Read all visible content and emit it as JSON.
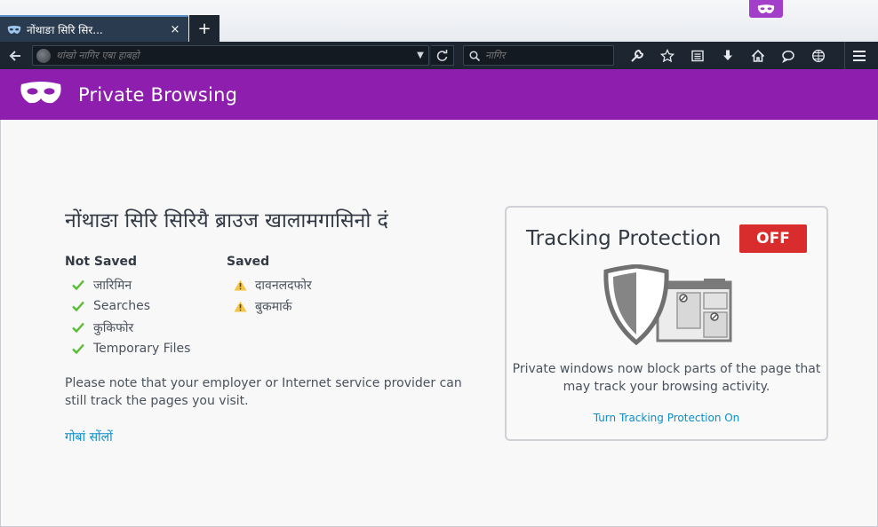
{
  "tab": {
    "title": "नोंथाङा सिरि सिर...",
    "close_label": "×",
    "new_tab_label": "+"
  },
  "navbar": {
    "url_placeholder": "थांखो नागिर एबा हाबहो",
    "search_placeholder": "नागिर",
    "icons": [
      "wrench-icon",
      "star-icon",
      "reader-icon",
      "download-icon",
      "home-icon",
      "chat-icon",
      "globe-grid-icon"
    ]
  },
  "header": {
    "title": "Private Browsing",
    "accent": "#8d1eae"
  },
  "main": {
    "heading": "नोंथाङा सिरि सिरियै ब्राउज खालामगासिनो दं",
    "not_saved": {
      "title": "Not Saved",
      "items": [
        "जारिमिन",
        "Searches",
        "कुकिफोर",
        "Temporary Files"
      ]
    },
    "saved": {
      "title": "Saved",
      "items": [
        "दावनलदफोर",
        "बुकमार्क"
      ]
    },
    "note": "Please note that your employer or Internet service provider can still track the pages you visit.",
    "learn_more": "गोबां सोंलों"
  },
  "tracking": {
    "title": "Tracking Protection",
    "toggle_label": "OFF",
    "toggle_color": "#d92d2d",
    "description": "Private windows now block parts of the page that may track your browsing activity.",
    "link": "Turn Tracking Protection On"
  }
}
